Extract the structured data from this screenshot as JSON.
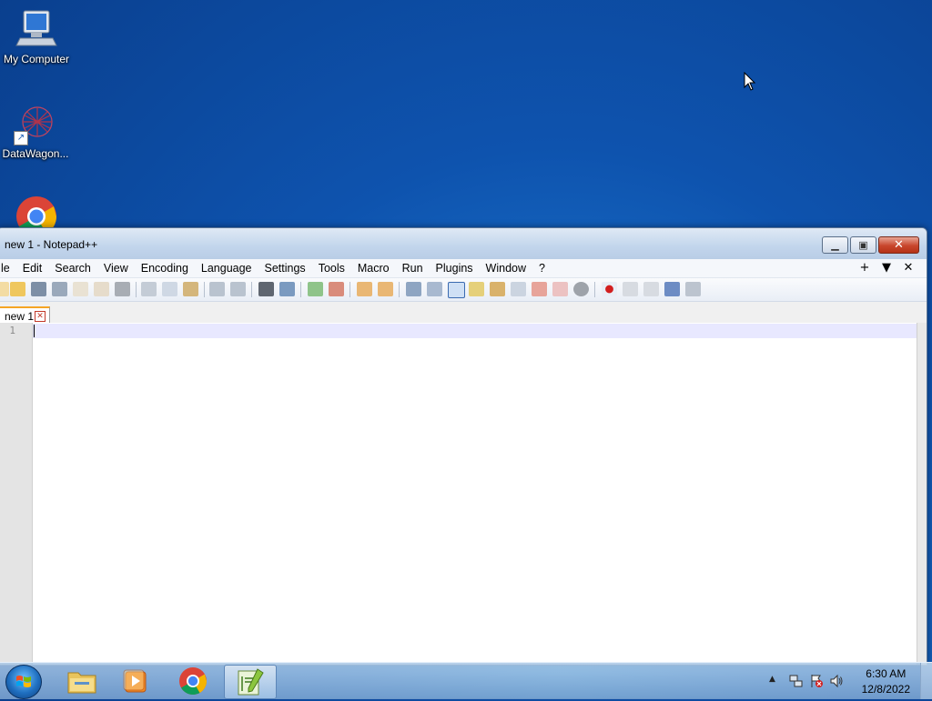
{
  "desktop": {
    "icons": [
      {
        "label": "My Computer"
      },
      {
        "label": "DataWagon..."
      },
      {
        "label": "Google Chrome"
      }
    ]
  },
  "window": {
    "title": "new 1 - Notepad++",
    "menu": [
      "le",
      "Edit",
      "Search",
      "View",
      "Encoding",
      "Language",
      "Settings",
      "Tools",
      "Macro",
      "Run",
      "Plugins",
      "Window",
      "?"
    ],
    "menu_right": [
      "+",
      "▼",
      "✕"
    ],
    "tab": {
      "label": "new 1"
    },
    "editor": {
      "line_numbers": [
        "1"
      ],
      "content": ""
    }
  },
  "taskbar": {
    "clock": {
      "time": "6:30 AM",
      "date": "12/8/2022"
    },
    "pinned": [
      "start-button",
      "file-explorer-icon",
      "media-player-icon",
      "chrome-icon",
      "notepadpp-icon"
    ]
  },
  "colors": {
    "desktop_bg": "#1c76cf",
    "title_gradient_top": "#dfe9f5",
    "close_button": "#c8462c",
    "tab_accent": "#f5a524",
    "current_line": "#e8e8ff"
  }
}
